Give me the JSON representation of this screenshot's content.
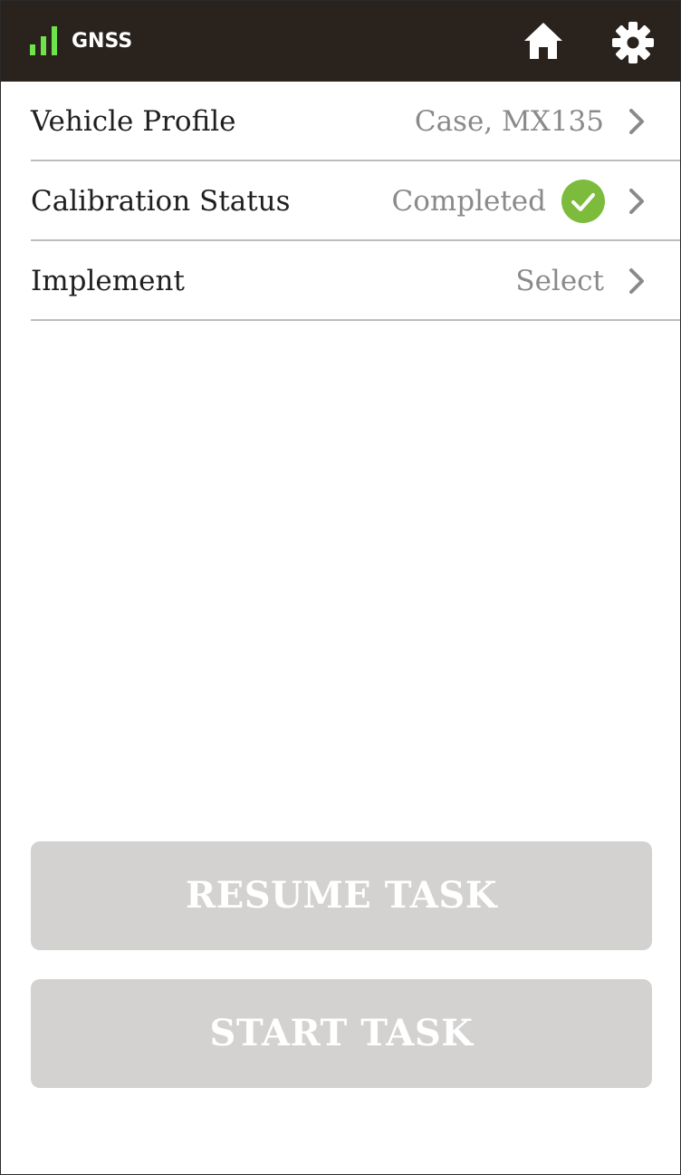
{
  "header": {
    "signal_icon": "signal-bars-icon",
    "gnss_label": "GNSS",
    "home_icon": "home-icon",
    "settings_icon": "gear-icon",
    "signal_color": "#6fe34a",
    "background_color": "#2a221d"
  },
  "rows": [
    {
      "label": "Vehicle Profile",
      "value": "Case, MX135",
      "icon": "chevron-right-icon"
    },
    {
      "label": "Calibration Status",
      "value": "Completed",
      "status_icon": "check-circle-icon",
      "status_color": "#7dbb3c",
      "icon": "chevron-right-icon"
    },
    {
      "label": "Implement",
      "value": "Select",
      "icon": "chevron-right-icon"
    }
  ],
  "buttons": {
    "resume_label": "RESUME TASK",
    "start_label": "START TASK",
    "disabled_color": "#d3d2d0"
  }
}
